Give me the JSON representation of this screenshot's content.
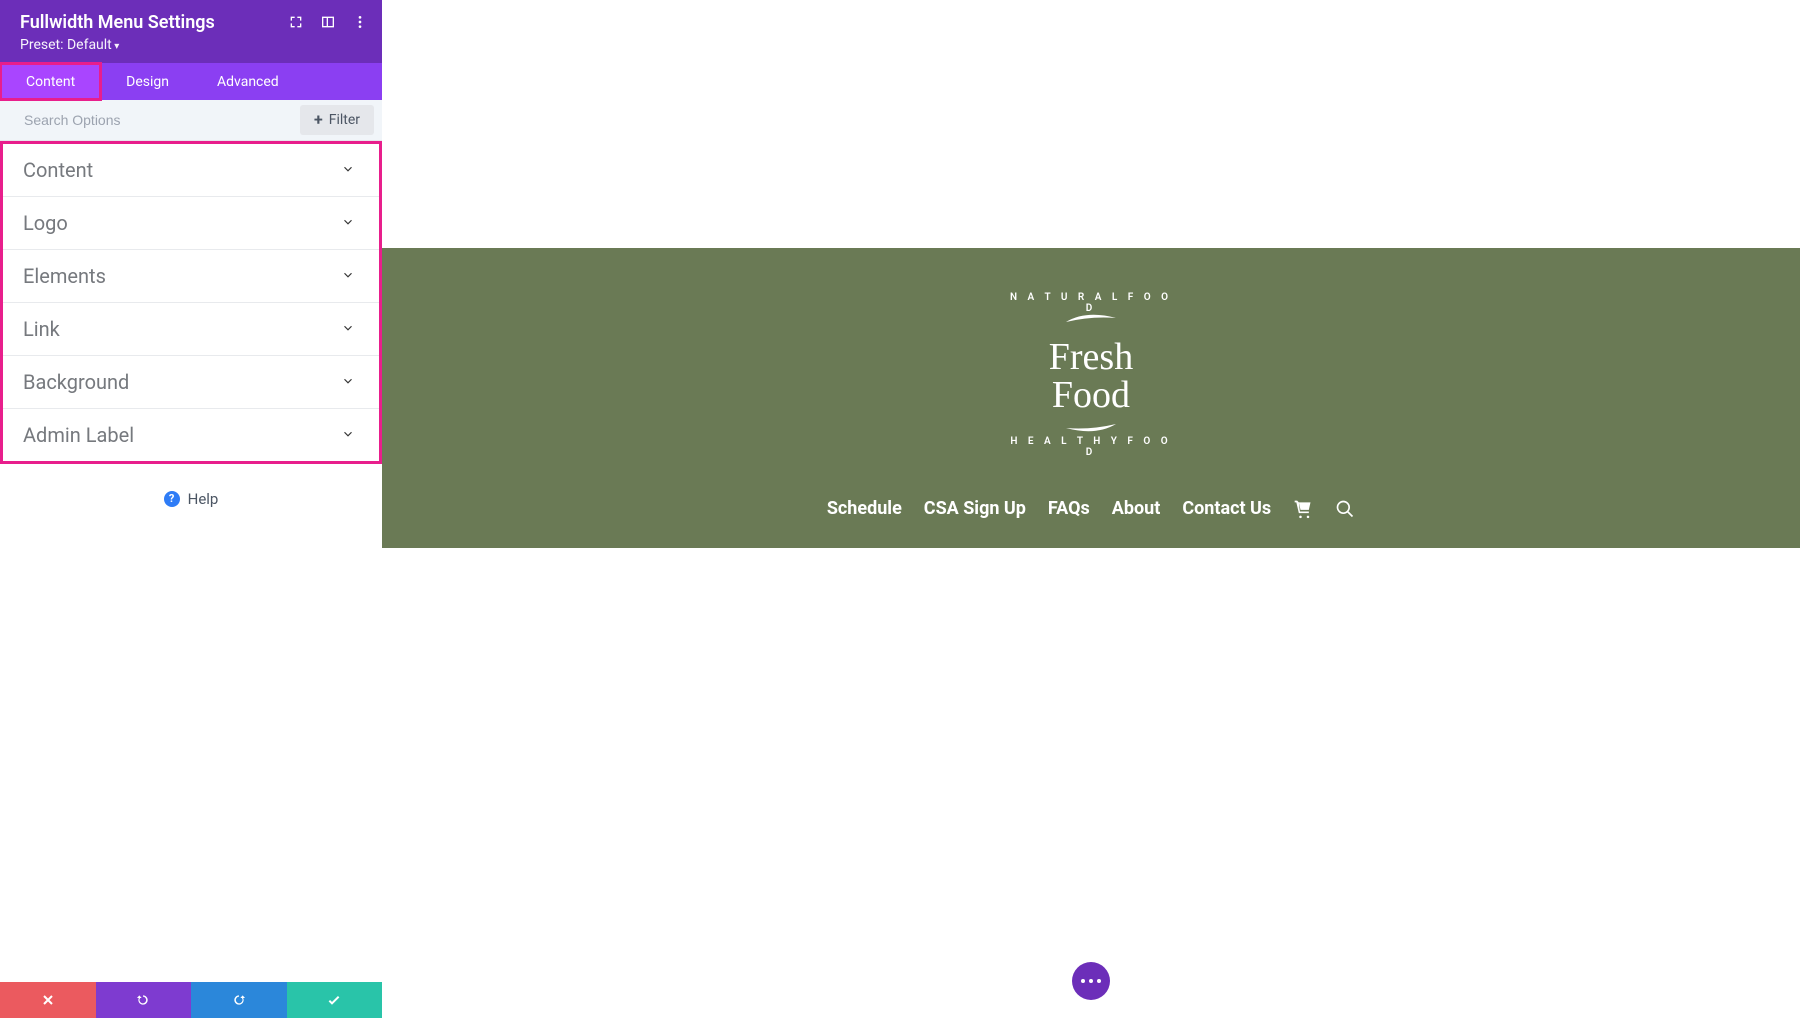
{
  "panel": {
    "title": "Fullwidth Menu Settings",
    "preset_label": "Preset: Default"
  },
  "tabs": {
    "content": "Content",
    "design": "Design",
    "advanced": "Advanced"
  },
  "search": {
    "placeholder": "Search Options",
    "filter_label": "Filter"
  },
  "sections": {
    "content": "Content",
    "logo": "Logo",
    "elements": "Elements",
    "link": "Link",
    "background": "Background",
    "admin_label": "Admin Label"
  },
  "help": {
    "label": "Help"
  },
  "preview": {
    "logo": {
      "top_arc": "N A T U R A L   F O O D",
      "name": "Fresh Food",
      "bottom_arc": "H E A L T H Y   F O O D"
    },
    "nav": {
      "items": [
        "Schedule",
        "CSA Sign Up",
        "FAQs",
        "About",
        "Contact Us"
      ]
    }
  },
  "colors": {
    "purple_dark": "#6c2eb9",
    "purple_mid": "#8b3ff2",
    "purple_active": "#a945ff",
    "pink_highlight": "#e81e8c",
    "red": "#eb5a5f",
    "blue": "#2b87da",
    "teal": "#29c4a9",
    "olive": "#6a7a55"
  }
}
